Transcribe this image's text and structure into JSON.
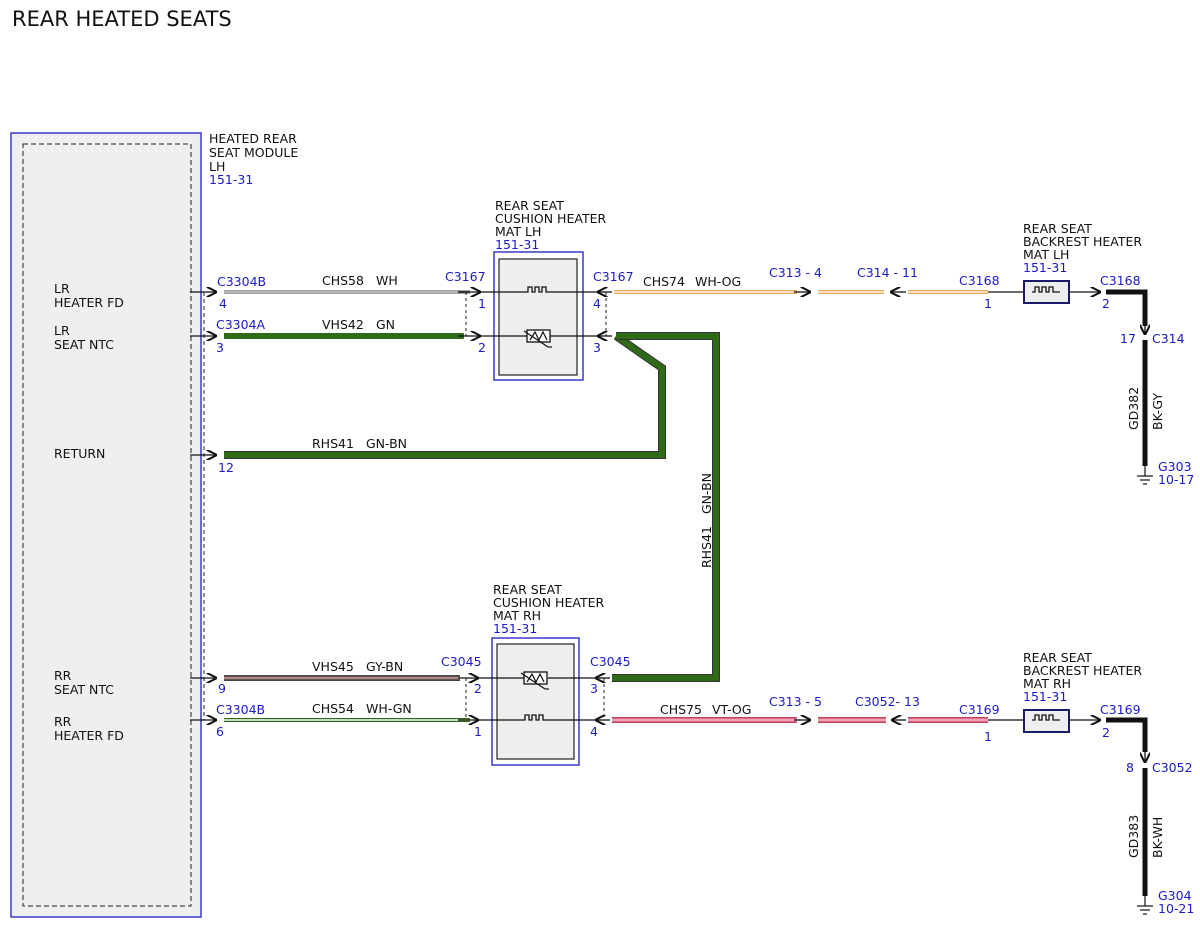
{
  "title": "REAR HEATED SEATS",
  "module": {
    "name": [
      "HEATED REAR",
      "SEAT MODULE",
      "LH"
    ],
    "ref": "151-31",
    "pins": {
      "lr_heater_fd": [
        "LR",
        "HEATER FD"
      ],
      "lr_seat_ntc": [
        "LR",
        "SEAT NTC"
      ],
      "return": "RETURN",
      "rr_seat_ntc": [
        "RR",
        "SEAT NTC"
      ],
      "rr_heater_fd": [
        "RR",
        "HEATER FD"
      ]
    }
  },
  "cushion_lh": {
    "name": [
      "REAR SEAT",
      "CUSHION HEATER",
      "MAT LH"
    ],
    "ref": "151-31"
  },
  "cushion_rh": {
    "name": [
      "REAR SEAT",
      "CUSHION HEATER",
      "MAT RH"
    ],
    "ref": "151-31"
  },
  "backrest_lh": {
    "name": [
      "REAR SEAT",
      "BACKREST HEATER",
      "MAT LH"
    ],
    "ref": "151-31"
  },
  "backrest_rh": {
    "name": [
      "REAR SEAT",
      "BACKREST HEATER",
      "MAT RH"
    ],
    "ref": "151-31"
  },
  "connectors": {
    "c3304b_top": "C3304B",
    "pin_4_left": "4",
    "c3304a": "C3304A",
    "pin_3_left": "3",
    "pin_12": "12",
    "pin_9": "9",
    "c3304b_bottom": "C3304B",
    "pin_6": "6",
    "c3167_left": "C3167",
    "c3167_left_p1": "1",
    "c3167_left_p2": "2",
    "c3167_right": "C3167",
    "c3167_right_p4": "4",
    "c3167_right_p3": "3",
    "c313_4": "C313 - 4",
    "c314_11": "C314 - 11",
    "c3168_left": "C3168",
    "c3168_left_p1": "1",
    "c3168_right": "C3168",
    "c3168_right_p2": "2",
    "c314": "C314",
    "c314_p17": "17",
    "g303": "G303",
    "g303_ref": "10-17",
    "c3045_left": "C3045",
    "c3045_left_p2": "2",
    "c3045_left_p1": "1",
    "c3045_right": "C3045",
    "c3045_right_p3": "3",
    "c3045_right_p4": "4",
    "c313_5": "C313 - 5",
    "c3052_13": "C3052- 13",
    "c3169_left": "C3169",
    "c3169_left_p1": "1",
    "c3169_right": "C3169",
    "c3169_right_p2": "2",
    "c3052": "C3052",
    "c3052_p8": "8",
    "g304": "G304",
    "g304_ref": "10-21"
  },
  "wires": {
    "chs58": {
      "circuit": "CHS58",
      "color": "WH"
    },
    "vhs42": {
      "circuit": "VHS42",
      "color": "GN"
    },
    "rhs41": {
      "circuit": "RHS41",
      "color": "GN-BN"
    },
    "rhs41_vertical": {
      "circuit": "RHS41",
      "color": "GN-BN"
    },
    "vhs45": {
      "circuit": "VHS45",
      "color": "GY-BN"
    },
    "chs54": {
      "circuit": "CHS54",
      "color": "WH-GN"
    },
    "chs74": {
      "circuit": "CHS74",
      "color": "WH-OG"
    },
    "chs75": {
      "circuit": "CHS75",
      "color": "VT-OG"
    },
    "gd382": {
      "circuit": "GD382",
      "color": "BK-GY"
    },
    "gd383": {
      "circuit": "GD383",
      "color": "BK-WH"
    }
  },
  "colors": {
    "link_blue": "#1a1acc",
    "green": "#2f6b16",
    "pink": "#e98aa0",
    "orange": "#e6a85a",
    "brown": "#7a5a52",
    "box_gray": "#eeeeee"
  }
}
